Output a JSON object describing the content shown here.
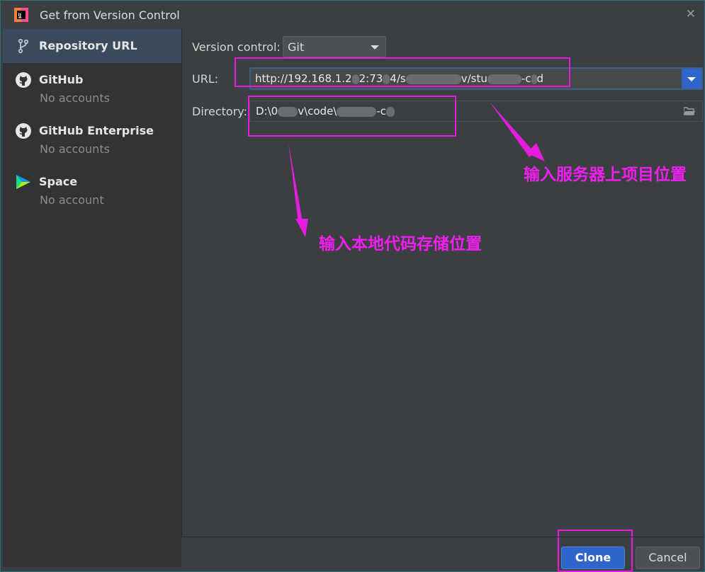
{
  "window": {
    "title": "Get from Version Control"
  },
  "sidebar": {
    "items": [
      {
        "label": "Repository URL",
        "sub": "",
        "icon": "branch-icon",
        "selected": true
      },
      {
        "label": "GitHub",
        "sub": "No accounts",
        "icon": "github-icon",
        "selected": false
      },
      {
        "label": "GitHub Enterprise",
        "sub": "No accounts",
        "icon": "github-icon",
        "selected": false
      },
      {
        "label": "Space",
        "sub": "No account",
        "icon": "space-icon",
        "selected": false
      }
    ]
  },
  "form": {
    "vcs_label": "Version control:",
    "vcs_value": "Git",
    "url_label": "URL:",
    "url_parts": [
      "http://192.168.1.2",
      "2:73",
      "4/s",
      "v/stu",
      "-c",
      "d"
    ],
    "directory_label": "Directory:",
    "directory_parts": [
      "D:\\0",
      "v\\code\\",
      "-c"
    ]
  },
  "annotations": {
    "server_note": "输入服务器上项目位置",
    "local_note": "输入本地代码存储位置"
  },
  "buttons": {
    "clone": "Clone",
    "cancel": "Cancel"
  },
  "colors": {
    "accent": "#2f65ca",
    "annotation": "#e51cdf",
    "background": "#3c3f41",
    "sidebar": "#313335"
  }
}
